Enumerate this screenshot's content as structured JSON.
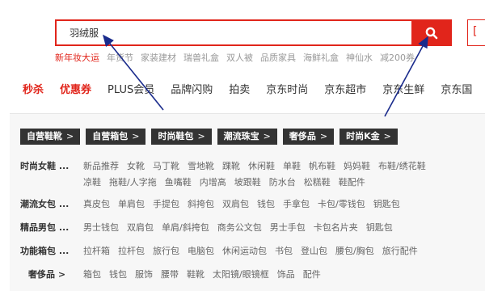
{
  "search": {
    "value": "羽绒服"
  },
  "hotwords": [
    "新年妆大运",
    "年货节",
    "家装建材",
    "瑞兽礼盒",
    "双人被",
    "品质家具",
    "海鲜礼盒",
    "神仙水",
    "减200券"
  ],
  "nav": [
    "秒杀",
    "优惠券",
    "PLUS会员",
    "品牌闪购",
    "拍卖",
    "京东时尚",
    "京东超市",
    "京东生鲜",
    "京东国"
  ],
  "chips": [
    "自营鞋靴",
    "自营箱包",
    "时尚鞋包",
    "潮流珠宝",
    "奢侈品",
    "时尚K金"
  ],
  "categories": [
    {
      "title": "时尚女鞋 ...",
      "items": [
        "新品推荐",
        "女靴",
        "马丁靴",
        "雪地靴",
        "踝靴",
        "休闲鞋",
        "单鞋",
        "帆布鞋",
        "妈妈鞋",
        "布鞋/绣花鞋"
      ]
    },
    {
      "title": "",
      "items": [
        "凉鞋",
        "拖鞋/人字拖",
        "鱼嘴鞋",
        "内增高",
        "坡跟鞋",
        "防水台",
        "松糕鞋",
        "鞋配件"
      ]
    },
    {
      "title": "潮流女包 ...",
      "items": [
        "真皮包",
        "单肩包",
        "手提包",
        "斜挎包",
        "双肩包",
        "钱包",
        "手拿包",
        "卡包/零钱包",
        "钥匙包"
      ]
    },
    {
      "title": "精品男包 ...",
      "items": [
        "男士钱包",
        "双肩包",
        "单肩/斜挎包",
        "商务公文包",
        "男士手包",
        "卡包名片夹",
        "钥匙包"
      ]
    },
    {
      "title": "功能箱包 ...",
      "items": [
        "拉杆箱",
        "拉杆包",
        "旅行包",
        "电脑包",
        "休闲运动包",
        "书包",
        "登山包",
        "腰包/胸包",
        "旅行配件"
      ]
    },
    {
      "title": "奢侈品 >",
      "items": [
        "箱包",
        "钱包",
        "服饰",
        "腰带",
        "鞋靴",
        "太阳镜/眼镜框",
        "饰品",
        "配件"
      ]
    }
  ],
  "colors": {
    "accent": "#e1251b",
    "arrow": "#1a2b8c"
  },
  "icons": {
    "search": "search-icon",
    "cart": "cart-icon"
  }
}
